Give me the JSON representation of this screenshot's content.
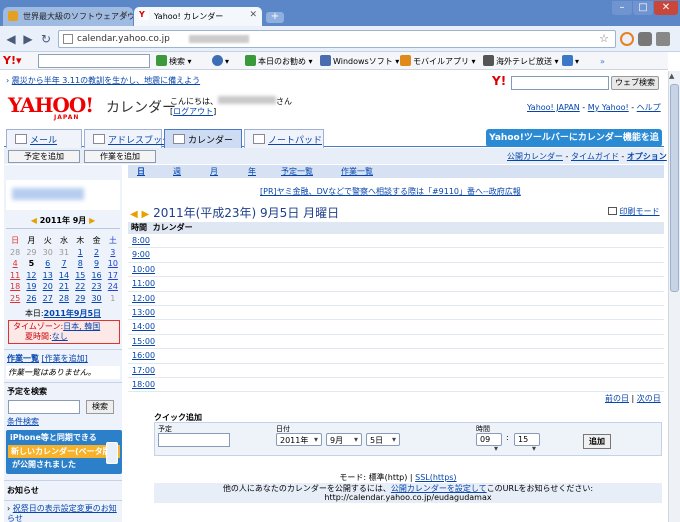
{
  "browser": {
    "tabs": [
      {
        "title": "世界最大級のソフトウェアダウ..."
      },
      {
        "title": "Yahoo! カレンダー"
      }
    ],
    "url": "calendar.yahoo.co.jp"
  },
  "toolbar": {
    "search_btn": "検索",
    "items": [
      "本日のお勧め",
      "Windowsソフト",
      "モバイルアプリ",
      "海外テレビ放送"
    ]
  },
  "notice": "震災から半年 3.11の教訓を生かし、地震に備えよう",
  "yahoo": {
    "search_btn": "ウェブ検索",
    "logo": "YAHOO!",
    "logo_sub": "JAPAN",
    "app": "カレンダー",
    "greeting_pre": "こんにちは、",
    "greeting_post": "さん",
    "logout": "ログアウト",
    "links": [
      "Yahoo! JAPAN",
      "My Yahoo!",
      "ヘルプ"
    ]
  },
  "apptabs": [
    "メール",
    "アドレスブック",
    "カレンダー",
    "ノートパッド"
  ],
  "promo": "Yahoo!ツールバーにカレンダー機能を追加",
  "actions": {
    "add_event": "予定を追加",
    "add_task": "作業を追加"
  },
  "rightlinks": [
    "公開カレンダー",
    "タイムガイド",
    "オプション"
  ],
  "viewtabs": [
    "日",
    "週",
    "月",
    "年",
    "予定一覧",
    "作業一覧"
  ],
  "pr": "[PR]ヤミ金融、DVなどで警察へ相談する際は「#9110」番へ--政府広報",
  "date_heading": "2011年(平成23年) 9月5日 月曜日",
  "print": "印刷モード",
  "col_time": "時間",
  "col_cal": "カレンダー",
  "hours": [
    "8:00",
    "9:00",
    "10:00",
    "11:00",
    "12:00",
    "13:00",
    "14:00",
    "15:00",
    "16:00",
    "17:00",
    "18:00"
  ],
  "prevday": "前の日",
  "nextday": "次の日",
  "minical": {
    "title": "2011年 9月",
    "dow": [
      "日",
      "月",
      "火",
      "水",
      "木",
      "金",
      "土"
    ],
    "days": [
      "28",
      "29",
      "30",
      "31",
      "1",
      "2",
      "3",
      "4",
      "5",
      "6",
      "7",
      "8",
      "9",
      "10",
      "11",
      "12",
      "13",
      "14",
      "15",
      "16",
      "17",
      "18",
      "19",
      "20",
      "21",
      "22",
      "23",
      "24",
      "25",
      "26",
      "27",
      "28",
      "29",
      "30",
      "1"
    ],
    "today_label": "本日:",
    "today": "2011年9月5日"
  },
  "tz": {
    "label": "タイムゾーン:",
    "value": "日本, 韓国",
    "dst_label": "夏時間:",
    "dst": "なし"
  },
  "tasks": {
    "title": "作業一覧",
    "add": "[作業を追加]",
    "empty": "作業一覧はありません。"
  },
  "search": {
    "title": "予定を検索",
    "btn": "検索",
    "cond": "条件検索"
  },
  "iphone": {
    "line1": "iPhone等と同期できる",
    "line2": "新しいカレンダー(ベータ版)",
    "line3": "が公開されました"
  },
  "news": {
    "title": "お知らせ",
    "item": "祝祭日の表示設定変更のお知らせ"
  },
  "quickadd": {
    "title": "クイック追加",
    "f_event": "予定",
    "f_date": "日付",
    "f_time": "時間",
    "year": "2011年",
    "month": "9月",
    "day": "5日",
    "hour": "09",
    "minute": "15",
    "btn": "追加"
  },
  "mode": {
    "label": "モード: 標準(http)",
    "ssl": "SSL(https)"
  },
  "publish": {
    "text1": "他の人にあなたのカレンダーを公開するには、",
    "link": "公開カレンダーを設定して",
    "text2": "このURLをお知らせください:",
    "url": "http://calendar.yahoo.co.jp/eudagudamax"
  }
}
